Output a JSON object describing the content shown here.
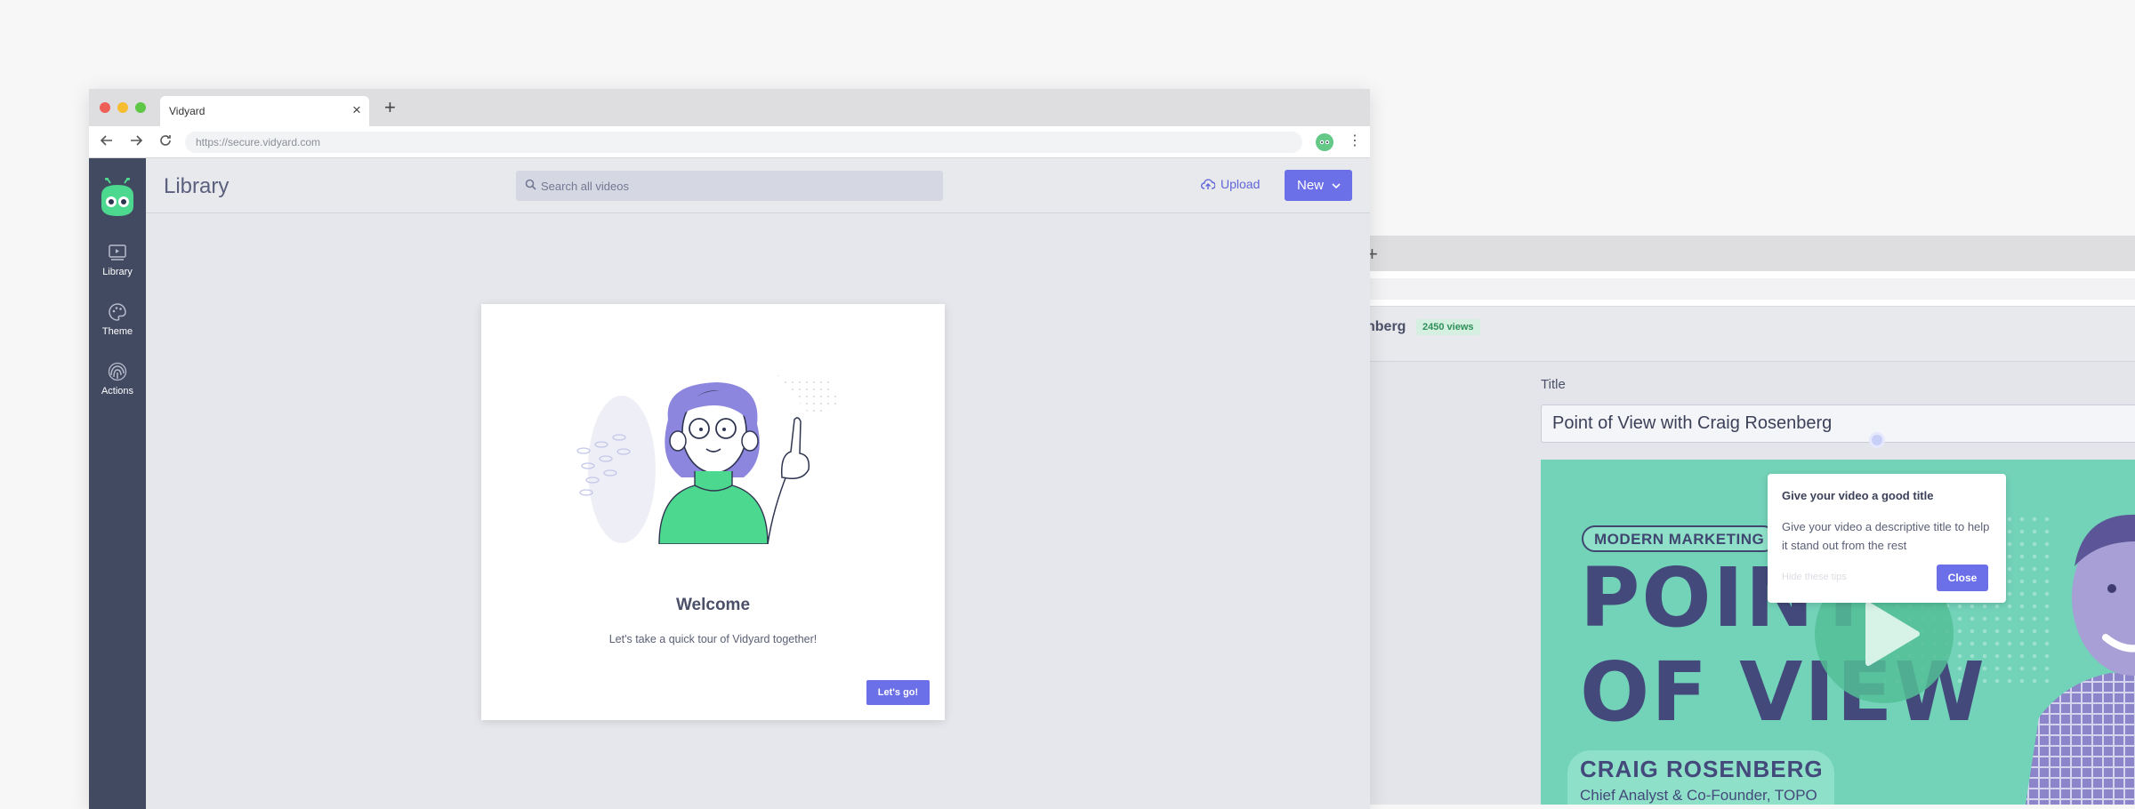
{
  "back_window": {
    "video_name_partial": "nberg",
    "views_badge": "2450 views",
    "title_label": "Title",
    "title_value": "Point of View with Craig Rosenberg",
    "thumbnail": {
      "pill": "MODERN MARKETING",
      "headline_line1": "POINT",
      "headline_line2": "OF VIEW",
      "name": "CRAIG ROSENBERG",
      "role": "Chief Analyst & Co-Founder, TOPO"
    },
    "tooltip": {
      "title": "Give your video a good title",
      "body": "Give your video a descriptive title to help it stand out from the rest",
      "hide_link": "Hide these tips",
      "close_label": "Close"
    }
  },
  "front_window": {
    "tab_title": "Vidyard",
    "url": "https://secure.vidyard.com",
    "sidebar": {
      "items": [
        {
          "label": "Library",
          "icon": "library-icon"
        },
        {
          "label": "Theme",
          "icon": "palette-icon"
        },
        {
          "label": "Actions",
          "icon": "fingerprint-icon"
        }
      ]
    },
    "header": {
      "title": "Library",
      "search_placeholder": "Search all videos",
      "upload_label": "Upload",
      "new_label": "New"
    },
    "modal": {
      "title": "Welcome",
      "subtitle": "Let's take a quick tour of Vidyard together!",
      "cta_label": "Let's go!"
    }
  },
  "colors": {
    "accent": "#6b6fe8",
    "sidebar": "#424a62",
    "brand_green": "#4cd98f"
  }
}
